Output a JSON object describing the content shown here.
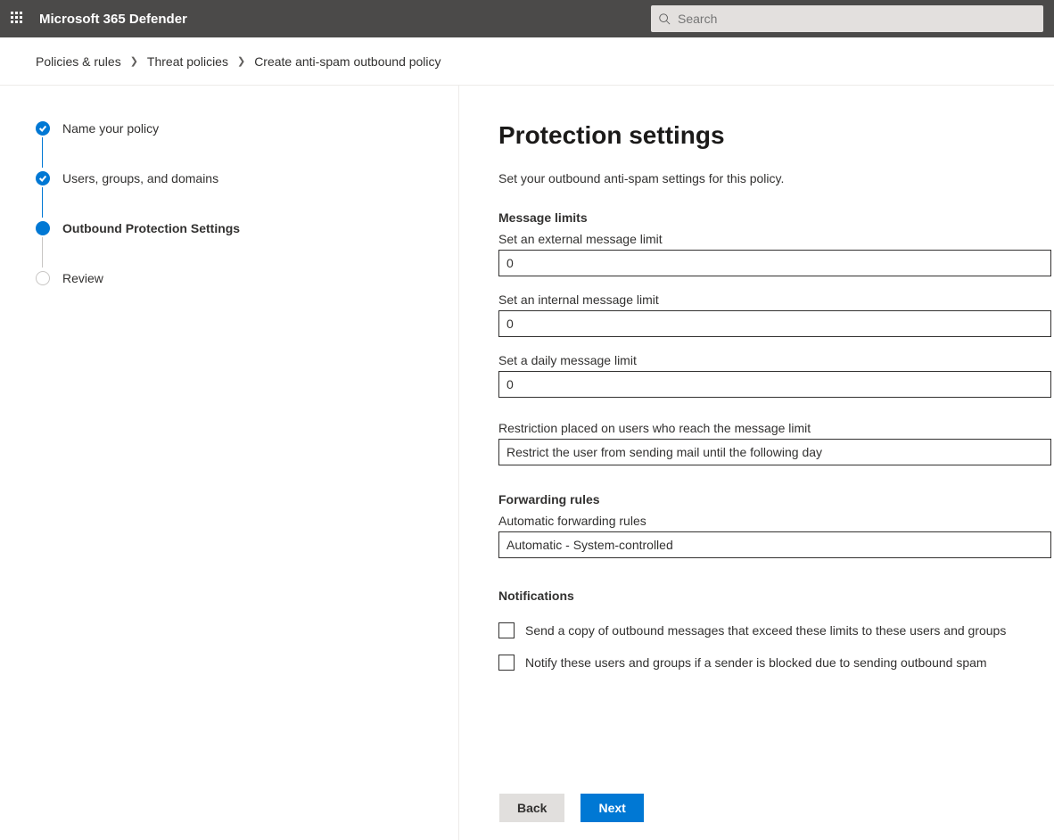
{
  "header": {
    "app_title": "Microsoft 365 Defender",
    "search_placeholder": "Search"
  },
  "breadcrumb": {
    "items": [
      "Policies & rules",
      "Threat policies",
      "Create anti-spam outbound policy"
    ]
  },
  "steps": [
    {
      "label": "Name your policy",
      "state": "done"
    },
    {
      "label": "Users, groups, and domains",
      "state": "done"
    },
    {
      "label": "Outbound Protection Settings",
      "state": "current"
    },
    {
      "label": "Review",
      "state": "todo"
    }
  ],
  "main": {
    "title": "Protection settings",
    "subtitle": "Set your outbound anti-spam settings for this policy.",
    "sections": {
      "message_limits": {
        "heading": "Message limits",
        "external_label": "Set an external message limit",
        "external_value": "0",
        "internal_label": "Set an internal message limit",
        "internal_value": "0",
        "daily_label": "Set a daily message limit",
        "daily_value": "0",
        "restriction_label": "Restriction placed on users who reach the message limit",
        "restriction_value": "Restrict the user from sending mail until the following day"
      },
      "forwarding": {
        "heading": "Forwarding rules",
        "auto_label": "Automatic forwarding rules",
        "auto_value": "Automatic - System-controlled"
      },
      "notifications": {
        "heading": "Notifications",
        "cb1_label": "Send a copy of outbound messages that exceed these limits to these users and groups",
        "cb2_label": "Notify these users and groups if a sender is blocked due to sending outbound spam"
      }
    },
    "buttons": {
      "back": "Back",
      "next": "Next"
    }
  }
}
